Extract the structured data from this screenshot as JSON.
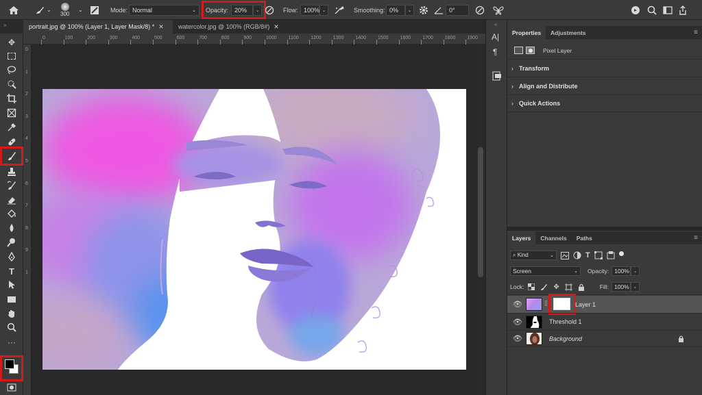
{
  "options_bar": {
    "brush_size": "300",
    "mode_label": "Mode:",
    "mode_value": "Normal",
    "opacity_label": "Opacity:",
    "opacity_value": "20%",
    "flow_label": "Flow:",
    "flow_value": "100%",
    "smoothing_label": "Smoothing:",
    "smoothing_value": "0%",
    "angle_value": "0°"
  },
  "tabs": [
    {
      "label": "portrait.jpg @ 100% (Layer 1, Layer Mask/8) *",
      "active": true
    },
    {
      "label": "watercolor.jpg @ 100% (RGB/8#)",
      "active": false
    }
  ],
  "ruler": {
    "top_ticks": [
      "0",
      "100",
      "200",
      "300",
      "400",
      "500",
      "600",
      "700",
      "800",
      "900",
      "1000",
      "1100",
      "1200",
      "1300",
      "1400",
      "1500",
      "1600",
      "1700",
      "1800",
      "1900"
    ],
    "left_ticks": [
      "0",
      "1",
      "2",
      "3",
      "4",
      "5",
      "6",
      "7",
      "8",
      "9",
      "1"
    ]
  },
  "tools": [
    "move-tool",
    "marquee-tool",
    "lasso-tool",
    "quick-select-tool",
    "crop-tool",
    "frame-tool",
    "eyedropper-tool",
    "healing-brush-tool",
    "brush-tool",
    "clone-stamp-tool",
    "history-brush-tool",
    "eraser-tool",
    "paint-bucket-tool",
    "blur-tool",
    "dodge-tool",
    "pen-tool",
    "type-tool",
    "path-select-tool",
    "rectangle-tool",
    "hand-tool",
    "zoom-tool",
    "more-tools"
  ],
  "properties_panel": {
    "tabs": [
      "Properties",
      "Adjustments"
    ],
    "pixel_layer_label": "Pixel Layer",
    "sections": [
      "Transform",
      "Align and Distribute",
      "Quick Actions"
    ]
  },
  "layers_panel": {
    "tabs": [
      "Layers",
      "Channels",
      "Paths"
    ],
    "filter_kind": "Kind",
    "blend_mode": "Screen",
    "opacity_label": "Opacity:",
    "opacity_value": "100%",
    "lock_label": "Lock:",
    "fill_label": "Fill:",
    "fill_value": "100%",
    "layers": [
      {
        "name": "Layer 1",
        "selected": true
      },
      {
        "name": "Threshold 1",
        "selected": false
      },
      {
        "name": "Background",
        "selected": false,
        "italic": true
      }
    ]
  },
  "colors": {
    "highlight": "#d41a1a",
    "foreground": "#000000",
    "background": "#ffffff"
  }
}
